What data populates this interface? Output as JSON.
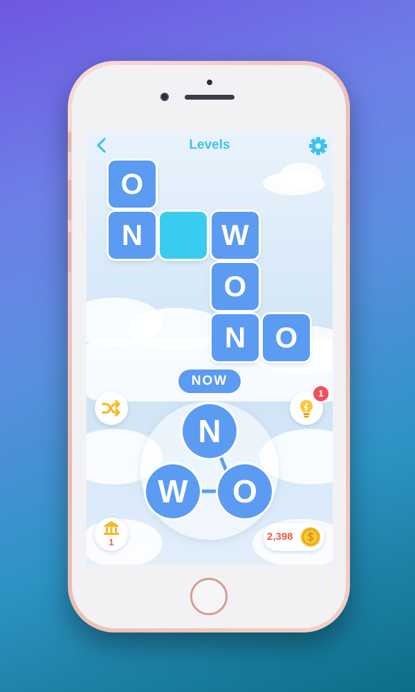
{
  "header": {
    "title": "Levels",
    "back_icon": "chevron-left-icon",
    "settings_icon": "gear-icon"
  },
  "crossword": {
    "tiles": [
      {
        "id": "r1c1",
        "letter": "O",
        "state": "filled"
      },
      {
        "id": "r2c1",
        "letter": "N",
        "state": "filled"
      },
      {
        "id": "r2c2",
        "letter": "",
        "state": "empty"
      },
      {
        "id": "r2c3",
        "letter": "W",
        "state": "filled"
      },
      {
        "id": "r3c3",
        "letter": "O",
        "state": "filled"
      },
      {
        "id": "r4c3",
        "letter": "N",
        "state": "filled"
      },
      {
        "id": "r4c4",
        "letter": "O",
        "state": "filled"
      }
    ]
  },
  "current_word": "NOW",
  "wheel": {
    "letters": [
      "N",
      "W",
      "O"
    ]
  },
  "controls": {
    "shuffle_icon": "shuffle-icon",
    "hint_icon": "lightbulb-icon",
    "hint_count": "1",
    "levels_icon": "bank-icon",
    "levels_count": "1",
    "coins": "2,398",
    "coin_icon": "dollar-coin-icon"
  },
  "colors": {
    "accent": "#3dc3ea",
    "tile": "#5b9bf1",
    "empty_tile": "#38cdf0",
    "badge": "#ef4f62",
    "coins_text": "#e85a4b",
    "coin": "#f5b921"
  }
}
